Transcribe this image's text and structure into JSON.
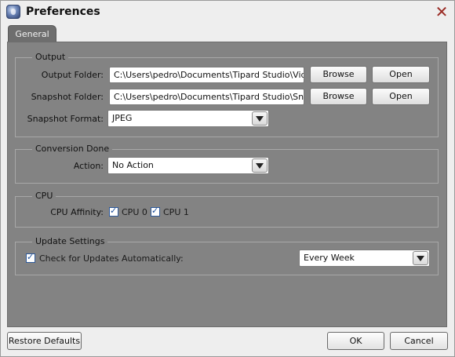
{
  "window": {
    "title": "Preferences"
  },
  "tabs": [
    {
      "label": "General"
    }
  ],
  "output": {
    "group_label": "Output",
    "output_folder_label": "Output Folder:",
    "output_folder_value": "C:\\Users\\pedro\\Documents\\Tipard Studio\\Video",
    "snapshot_folder_label": "Snapshot Folder:",
    "snapshot_folder_value": "C:\\Users\\pedro\\Documents\\Tipard Studio\\Snapsho",
    "browse_label": "Browse",
    "open_label": "Open",
    "snapshot_format_label": "Snapshot Format:",
    "snapshot_format_value": "JPEG"
  },
  "conversion": {
    "group_label": "Conversion Done",
    "action_label": "Action:",
    "action_value": "No Action"
  },
  "cpu": {
    "group_label": "CPU",
    "affinity_label": "CPU Affinity:",
    "cores": [
      {
        "label": "CPU 0",
        "checked": true
      },
      {
        "label": "CPU 1",
        "checked": true
      }
    ]
  },
  "update": {
    "group_label": "Update Settings",
    "auto_check_label": "Check for Updates Automatically:",
    "auto_check_checked": true,
    "frequency_value": "Every Week"
  },
  "footer": {
    "restore_label": "Restore Defaults",
    "ok_label": "OK",
    "cancel_label": "Cancel"
  },
  "icons": {
    "app": "app-logo-icon",
    "close": "close-icon",
    "dropdown": "chevron-down-icon",
    "check": "checkbox-checked-icon"
  },
  "colors": {
    "panel": "#838383",
    "tab_active": "#6e6e6e",
    "close": "#9a2b24",
    "check": "#1b4e9a"
  }
}
